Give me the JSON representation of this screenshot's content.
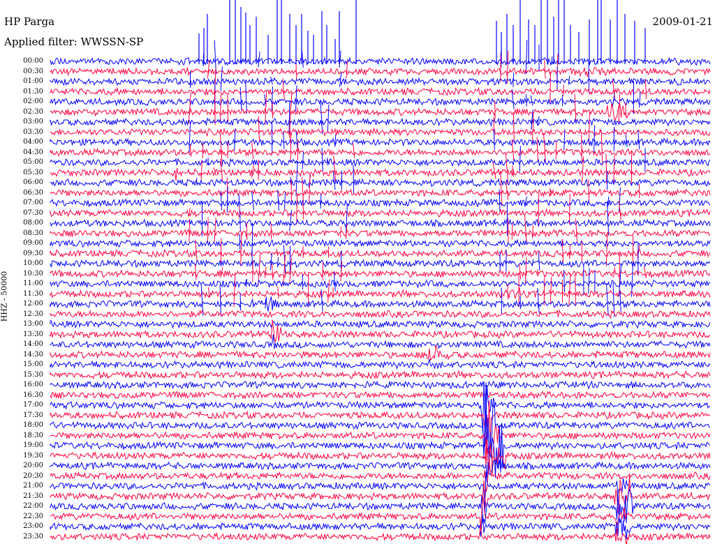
{
  "header": {
    "station": "HP Parga",
    "filter": "Applied filter: WWSSN-SP",
    "date": "2009-01-21"
  },
  "channel_label": "HHZ - 50000",
  "colors": {
    "trace_a": "#0000ff",
    "trace_b": "#ff0040",
    "background": "#ffffff"
  },
  "time_labels": [
    "00:00",
    "00:30",
    "01:00",
    "01:30",
    "02:00",
    "02:30",
    "03:00",
    "03:30",
    "04:00",
    "04:30",
    "05:00",
    "05:30",
    "06:00",
    "06:30",
    "07:00",
    "07:30",
    "08:00",
    "08:30",
    "09:00",
    "09:30",
    "10:00",
    "10:30",
    "11:00",
    "11:30",
    "12:00",
    "12:30",
    "13:00",
    "13:30",
    "14:00",
    "14:30",
    "15:00",
    "15:30",
    "16:00",
    "16:30",
    "17:00",
    "17:30",
    "18:00",
    "18:30",
    "19:00",
    "19:30",
    "20:00",
    "20:30",
    "21:00",
    "21:30",
    "22:00",
    "22:30",
    "23:00",
    "23:30"
  ]
}
